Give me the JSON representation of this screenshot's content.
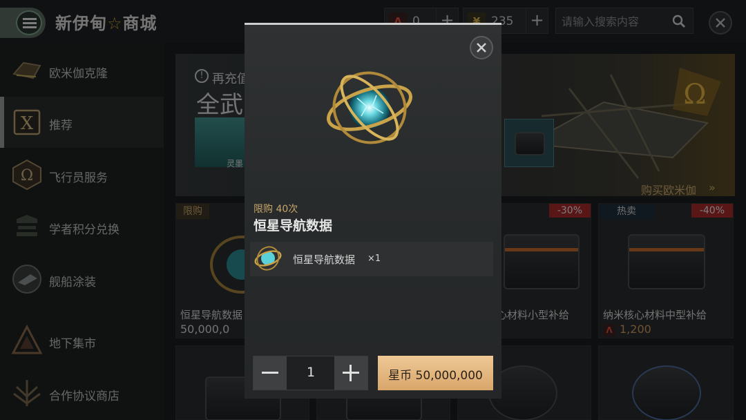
{
  "header": {
    "store_title_left": "新伊甸",
    "store_title_star": "☆",
    "store_title_right": "商城",
    "currencies": [
      {
        "icon": "alpha-credit-icon",
        "symbol": "Λ",
        "value": "0",
        "color": "#c0392b"
      },
      {
        "icon": "yen-token-icon",
        "symbol": "¥",
        "value": "235",
        "color": "#c9a23c"
      }
    ],
    "search_placeholder": "请输入搜索内容"
  },
  "sidebar": {
    "items": [
      {
        "label": "欧米伽克隆",
        "icon": "omega-clone-icon",
        "active": false
      },
      {
        "label": "推荐",
        "icon": "recommend-icon",
        "active": true
      },
      {
        "label": "飞行员服务",
        "icon": "omega-pilot-icon",
        "active": false
      },
      {
        "label": "学者积分兑换",
        "icon": "scholar-icon",
        "active": false
      },
      {
        "label": "舰船涂装",
        "icon": "ship-paint-icon",
        "active": false
      },
      {
        "label": "地下集市",
        "icon": "underground-market-icon",
        "active": false
      },
      {
        "label": "合作协议商店",
        "icon": "cooperation-store-icon",
        "active": false
      }
    ]
  },
  "banner": {
    "notice": "再充值",
    "title": "全武",
    "thumb_label": "灵墨",
    "buy_link": "购买欧米伽",
    "buy_chevron": "»"
  },
  "cards": [
    {
      "tag": "限购",
      "name": "恒星导航数据",
      "price": "50,000,0",
      "discount": ""
    },
    {
      "tag": "",
      "name": "心材料小型补给",
      "price": "",
      "discount": "-30%"
    },
    {
      "tag": "热卖",
      "name": "纳米核心材料中型补给",
      "price": "1,200",
      "discount": "-40%"
    }
  ],
  "modal": {
    "limit_label": "限购 40次",
    "item_name": "恒星导航数据",
    "content_name": "恒星导航数据",
    "content_qty": "×1",
    "quantity": "1",
    "buy_label": "星币 50,000,000"
  },
  "colors": {
    "accent_gold": "#c9a66a",
    "buy_button": "#e4b77e",
    "discount_red": "#a32a2a"
  }
}
